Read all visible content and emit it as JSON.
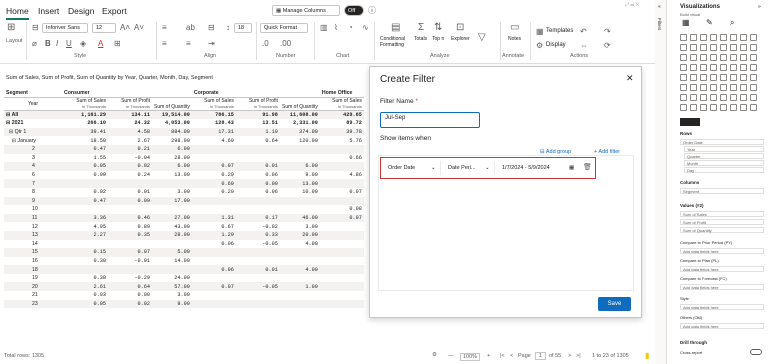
{
  "ribbon": {
    "tabs": [
      "Home",
      "Insert",
      "Design",
      "Export"
    ],
    "font_name": "Inforiver Sans",
    "font_size": "12",
    "number_size": "18",
    "quick_format": "Quick Format",
    "manage_columns": "Manage Columns",
    "toggle_label": "Off",
    "groups": {
      "layout": "Layout",
      "style": "Style",
      "align": "Align",
      "number": "Number",
      "chart": "Chart",
      "analyze": "Analyze",
      "annotate": "Annotate",
      "actions": "Actions"
    },
    "analyze_items": [
      "Conditional Formatting",
      "Totals",
      "Top n",
      "Explorer"
    ],
    "notes": "Notes",
    "templates": "Templates",
    "display": "Display"
  },
  "report": {
    "subtitle": "Sum of Sales, Sum of Profit, Sum of Quantity by Year, Quarter, Month, Day, Segment",
    "row_header_segment": "Segment",
    "row_header_year": "Year",
    "segments": [
      "Consumer",
      "Corporate",
      "Home Office"
    ],
    "measure_headers": [
      {
        "name": "Sum of Sales",
        "sub": "in Thousands"
      },
      {
        "name": "Sum of Profit",
        "sub": "in Thousands"
      },
      {
        "name": "Sum of Quantity",
        "sub": ""
      }
    ],
    "rows": [
      {
        "label": "⊟ All",
        "cells": [
          "1,161.29",
          "134.11",
          "19,514.00",
          "786.15",
          "91.98",
          "11,608.00",
          "429.65"
        ],
        "bold": true
      },
      {
        "label": "⊟ 2021",
        "cells": [
          "266.10",
          "24.32",
          "4,053.00",
          "128.43",
          "13.51",
          "2,331.00",
          "89.72"
        ],
        "bold": true
      },
      {
        "label": "  ⊟ Qtr 1",
        "cells": [
          "39.41",
          "4.58",
          "884.00",
          "17.31",
          "1.19",
          "374.00",
          "39.78"
        ],
        "bold": false
      },
      {
        "label": "    ⊟ January",
        "cells": [
          "18.50",
          "2.67",
          "298.00",
          "4.69",
          "0.64",
          "120.00",
          "5.76"
        ],
        "bold": false
      },
      {
        "label": "2",
        "cells": [
          "0.47",
          "0.21",
          "6.00",
          "",
          "",
          "",
          ""
        ],
        "bold": false
      },
      {
        "label": "3",
        "cells": [
          "1.55",
          "-0.04",
          "28.00",
          "",
          "",
          "",
          "0.66"
        ],
        "bold": false
      },
      {
        "label": "4",
        "cells": [
          "0.05",
          "0.02",
          "6.00",
          "0.07",
          "0.01",
          "6.00",
          ""
        ],
        "bold": false
      },
      {
        "label": "6",
        "cells": [
          "0.90",
          "0.24",
          "13.00",
          "0.20",
          "0.06",
          "9.00",
          "4.86"
        ],
        "bold": false
      },
      {
        "label": "7",
        "cells": [
          "",
          "",
          "",
          "0.60",
          "0.00",
          "13.00",
          ""
        ],
        "bold": false
      },
      {
        "label": "8",
        "cells": [
          "0.02",
          "0.01",
          "3.00",
          "0.20",
          "0.06",
          "10.00",
          "0.07"
        ],
        "bold": false
      },
      {
        "label": "9",
        "cells": [
          "0.47",
          "0.09",
          "17.00",
          "",
          "",
          "",
          ""
        ],
        "bold": false
      },
      {
        "label": "10",
        "cells": [
          "",
          "",
          "",
          "",
          "",
          "",
          "0.08"
        ],
        "bold": false
      },
      {
        "label": "11",
        "cells": [
          "3.36",
          "0.46",
          "27.00",
          "1.31",
          "0.17",
          "46.00",
          "0.07"
        ],
        "bold": false
      },
      {
        "label": "12",
        "cells": [
          "4.95",
          "0.89",
          "43.00",
          "0.67",
          "-0.02",
          "3.00",
          ""
        ],
        "bold": false
      },
      {
        "label": "13",
        "cells": [
          "2.27",
          "0.35",
          "28.00",
          "1.29",
          "0.33",
          "20.00",
          ""
        ],
        "bold": false
      },
      {
        "label": "14",
        "cells": [
          "",
          "",
          "",
          "0.06",
          "-0.05",
          "4.00",
          ""
        ],
        "bold": false
      },
      {
        "label": "15",
        "cells": [
          "0.15",
          "0.07",
          "5.00",
          "",
          "",
          "",
          ""
        ],
        "bold": false
      },
      {
        "label": "16",
        "cells": [
          "0.30",
          "-0.01",
          "14.00",
          "",
          "",
          "",
          ""
        ],
        "bold": false
      },
      {
        "label": "18",
        "cells": [
          "",
          "",
          "",
          "0.06",
          "0.01",
          "4.00",
          ""
        ],
        "bold": false
      },
      {
        "label": "19",
        "cells": [
          "0.38",
          "-0.29",
          "24.00",
          "",
          "",
          "",
          ""
        ],
        "bold": false
      },
      {
        "label": "20",
        "cells": [
          "2.61",
          "0.64",
          "57.00",
          "0.07",
          "-0.05",
          "1.00",
          ""
        ],
        "bold": false
      },
      {
        "label": "21",
        "cells": [
          "0.03",
          "0.00",
          "3.00",
          "",
          "",
          "",
          ""
        ],
        "bold": false
      },
      {
        "label": "23",
        "cells": [
          "0.05",
          "0.02",
          "9.00",
          "",
          "",
          "",
          ""
        ],
        "bold": false
      }
    ]
  },
  "status": {
    "total_rows": "Total rows: 1305",
    "zoom": "100%",
    "page_label": "Page",
    "page_value": "1",
    "page_of": "of 55",
    "range": "1 to 23 of 1305"
  },
  "dialog": {
    "title": "Create Filter",
    "filter_name_label": "Filter Name",
    "required_mark": "*",
    "filter_name_value": "Jul-Sep",
    "show_items_label": "Show items when",
    "add_group": "Add group",
    "add_filter": "+ Add filter",
    "field": "Order Date",
    "operator": "Date Peri...",
    "date_range": "1/7/2024 - 5/9/2024",
    "save": "Save"
  },
  "viz_panel": {
    "title": "Visualizations",
    "subtitle": "Build visual",
    "filters_label": "Filters",
    "rows_label": "Rows",
    "row_fields": [
      "Order Date",
      "Year",
      "Quarter",
      "Month",
      "Day"
    ],
    "columns_label": "Columns",
    "column_fields": [
      "Segment"
    ],
    "values_label": "Values (#2)",
    "value_fields": [
      "Sum of Sales",
      "Sum of Profit",
      "Sum of Quantity"
    ],
    "compare_prior": "Compare to Prior Period (PY)",
    "compare_plan": "Compare to Plan (PL)",
    "compare_forecast": "Compare to Forecast (FC)",
    "style": "Style",
    "others": "Others (OM)",
    "add_placeholder": "Add data fields here",
    "drill_through": "Drill through",
    "cross_report": "Cross-report",
    "accent": "#117865",
    "save_color": "#0f6cbd",
    "highlight_color": "#d13438"
  }
}
